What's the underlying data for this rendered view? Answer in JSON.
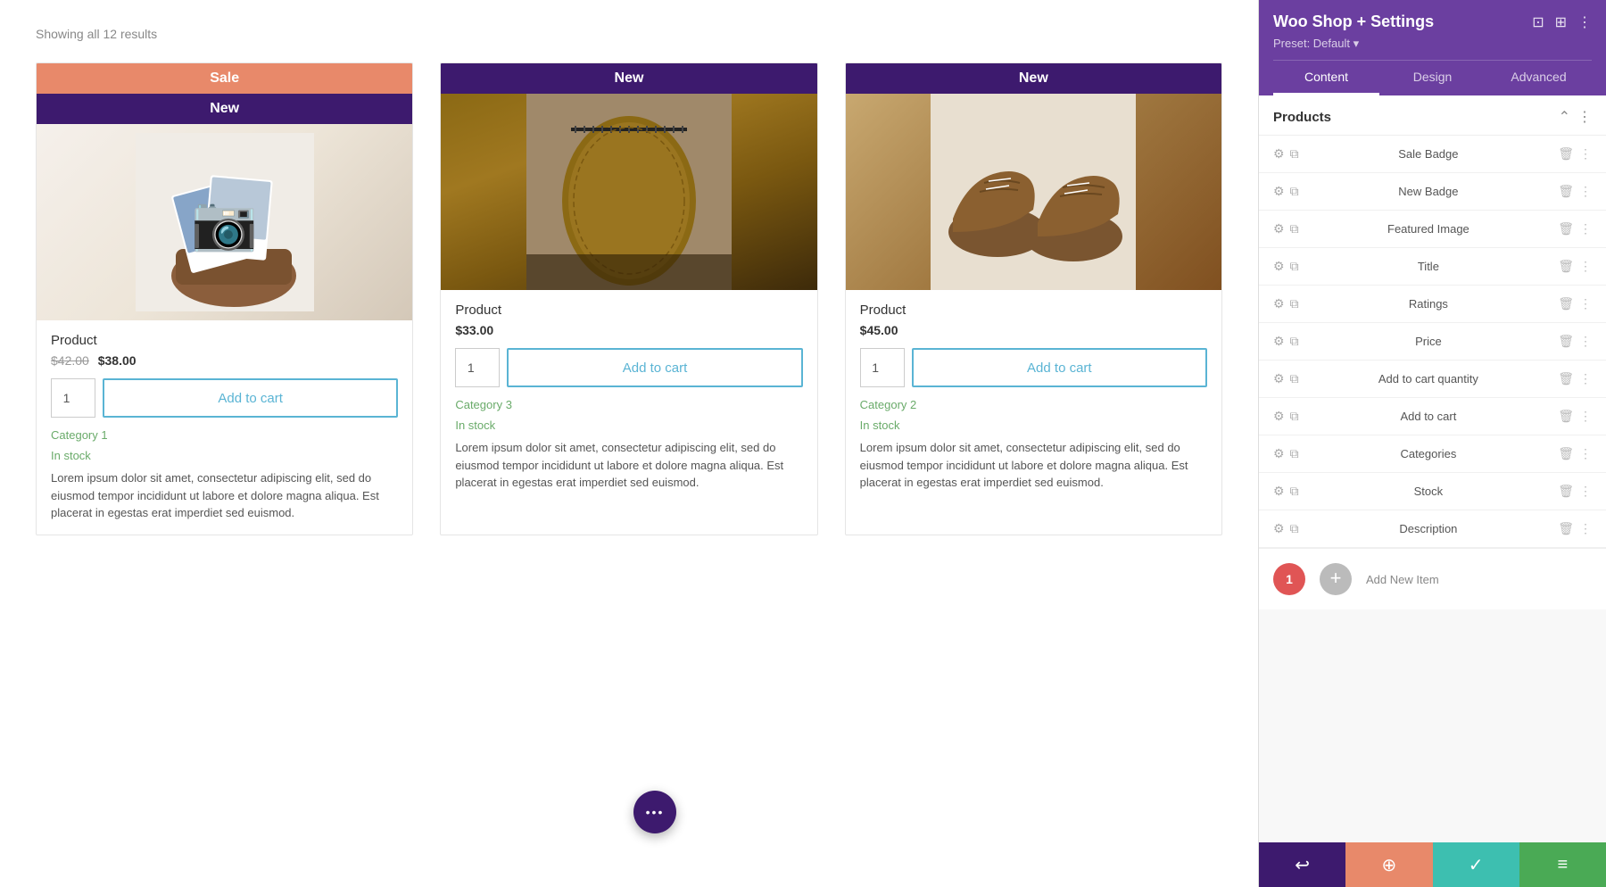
{
  "main": {
    "results_count": "Showing all 12 results",
    "products": [
      {
        "id": 1,
        "badge_sale": "Sale",
        "badge_new": "New",
        "image_type": "camera",
        "title": "Product",
        "old_price": "$42.00",
        "new_price": "$38.00",
        "qty": "1",
        "add_to_cart_label": "Add to cart",
        "category": "Category 1",
        "stock": "In stock",
        "description": "Lorem ipsum dolor sit amet, consectetur adipiscing elit, sed do eiusmod tempor incididunt ut labore et dolore magna aliqua. Est placerat in egestas erat imperdiet sed euismod."
      },
      {
        "id": 2,
        "badge_new": "New",
        "image_type": "pouch",
        "title": "Product",
        "price": "$33.00",
        "qty": "1",
        "add_to_cart_label": "Add to cart",
        "category": "Category 3",
        "stock": "In stock",
        "description": "Lorem ipsum dolor sit amet, consectetur adipiscing elit, sed do eiusmod tempor incididunt ut labore et dolore magna aliqua. Est placerat in egestas erat imperdiet sed euismod."
      },
      {
        "id": 3,
        "badge_new": "New",
        "image_type": "shoes",
        "title": "Product",
        "price": "$45.00",
        "qty": "1",
        "add_to_cart_label": "Add to cart",
        "category": "Category 2",
        "stock": "In stock",
        "description": "Lorem ipsum dolor sit amet, consectetur adipiscing elit, sed do eiusmod tempor incididunt ut labore et dolore magna aliqua. Est placerat in egestas erat imperdiet sed euismod."
      }
    ],
    "fab_icon": "•••"
  },
  "panel": {
    "title": "Woo Shop + Settings",
    "preset_label": "Preset: Default",
    "tabs": [
      "Content",
      "Design",
      "Advanced"
    ],
    "active_tab": "Content",
    "section_title": "Products",
    "items": [
      {
        "label": "Sale Badge"
      },
      {
        "label": "New Badge"
      },
      {
        "label": "Featured Image"
      },
      {
        "label": "Title"
      },
      {
        "label": "Ratings"
      },
      {
        "label": "Price"
      },
      {
        "label": "Add to cart quantity"
      },
      {
        "label": "Add to cart"
      },
      {
        "label": "Categories"
      },
      {
        "label": "Stock"
      },
      {
        "label": "Description"
      }
    ],
    "footer": {
      "badge_count": "1",
      "add_label": "Add New Item"
    },
    "bottom_buttons": [
      {
        "icon": "↩",
        "color": "purple"
      },
      {
        "icon": "⊕",
        "color": "orange"
      },
      {
        "icon": "✓",
        "color": "teal"
      },
      {
        "icon": "≡",
        "color": "green"
      }
    ]
  }
}
